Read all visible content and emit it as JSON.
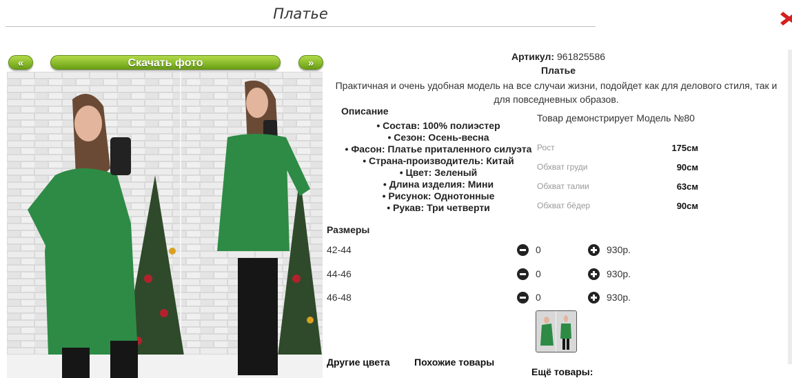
{
  "header": {
    "title": "Платье"
  },
  "gallery": {
    "prev_label": "«",
    "next_label": "»",
    "download_label": "Скачать фото"
  },
  "product": {
    "article_label": "Артикул:",
    "article_value": "961825586",
    "name": "Платье",
    "description": "Практичная и очень удобная модель на все случаи жизни, подойдет как для делового стиля, так и для повседневных образов."
  },
  "details": {
    "title": "Описание",
    "items": [
      "Состав: 100% полиэстер",
      "Сезон: Осень-весна",
      "Фасон: Платье приталенного силуэта",
      "Страна-производитель: Китай",
      "Цвет: Зеленый",
      "Длина изделия: Мини",
      "Рисунок: Однотонные",
      "Рукав: Три четверти"
    ]
  },
  "model": {
    "text": "Товар демонстрирует Модель №80",
    "measurements": [
      {
        "label": "Рост",
        "value": "175см"
      },
      {
        "label": "Обхват груди",
        "value": "90см"
      },
      {
        "label": "Обхват талии",
        "value": "63см"
      },
      {
        "label": "Обхват бёдер",
        "value": "90см"
      }
    ]
  },
  "sizes": {
    "title": "Размеры",
    "rows": [
      {
        "size": "42-44",
        "qty": "0",
        "price": "930р."
      },
      {
        "size": "44-46",
        "qty": "0",
        "price": "930р."
      },
      {
        "size": "46-48",
        "qty": "0",
        "price": "930р."
      }
    ]
  },
  "links": {
    "other_colors": "Другие цвета",
    "similar": "Похожие товары",
    "more": "Ещё товары:"
  },
  "colors": {
    "button_green": "#7ab51d",
    "dress_green": "#2e8b45",
    "close_red": "#d42020"
  }
}
